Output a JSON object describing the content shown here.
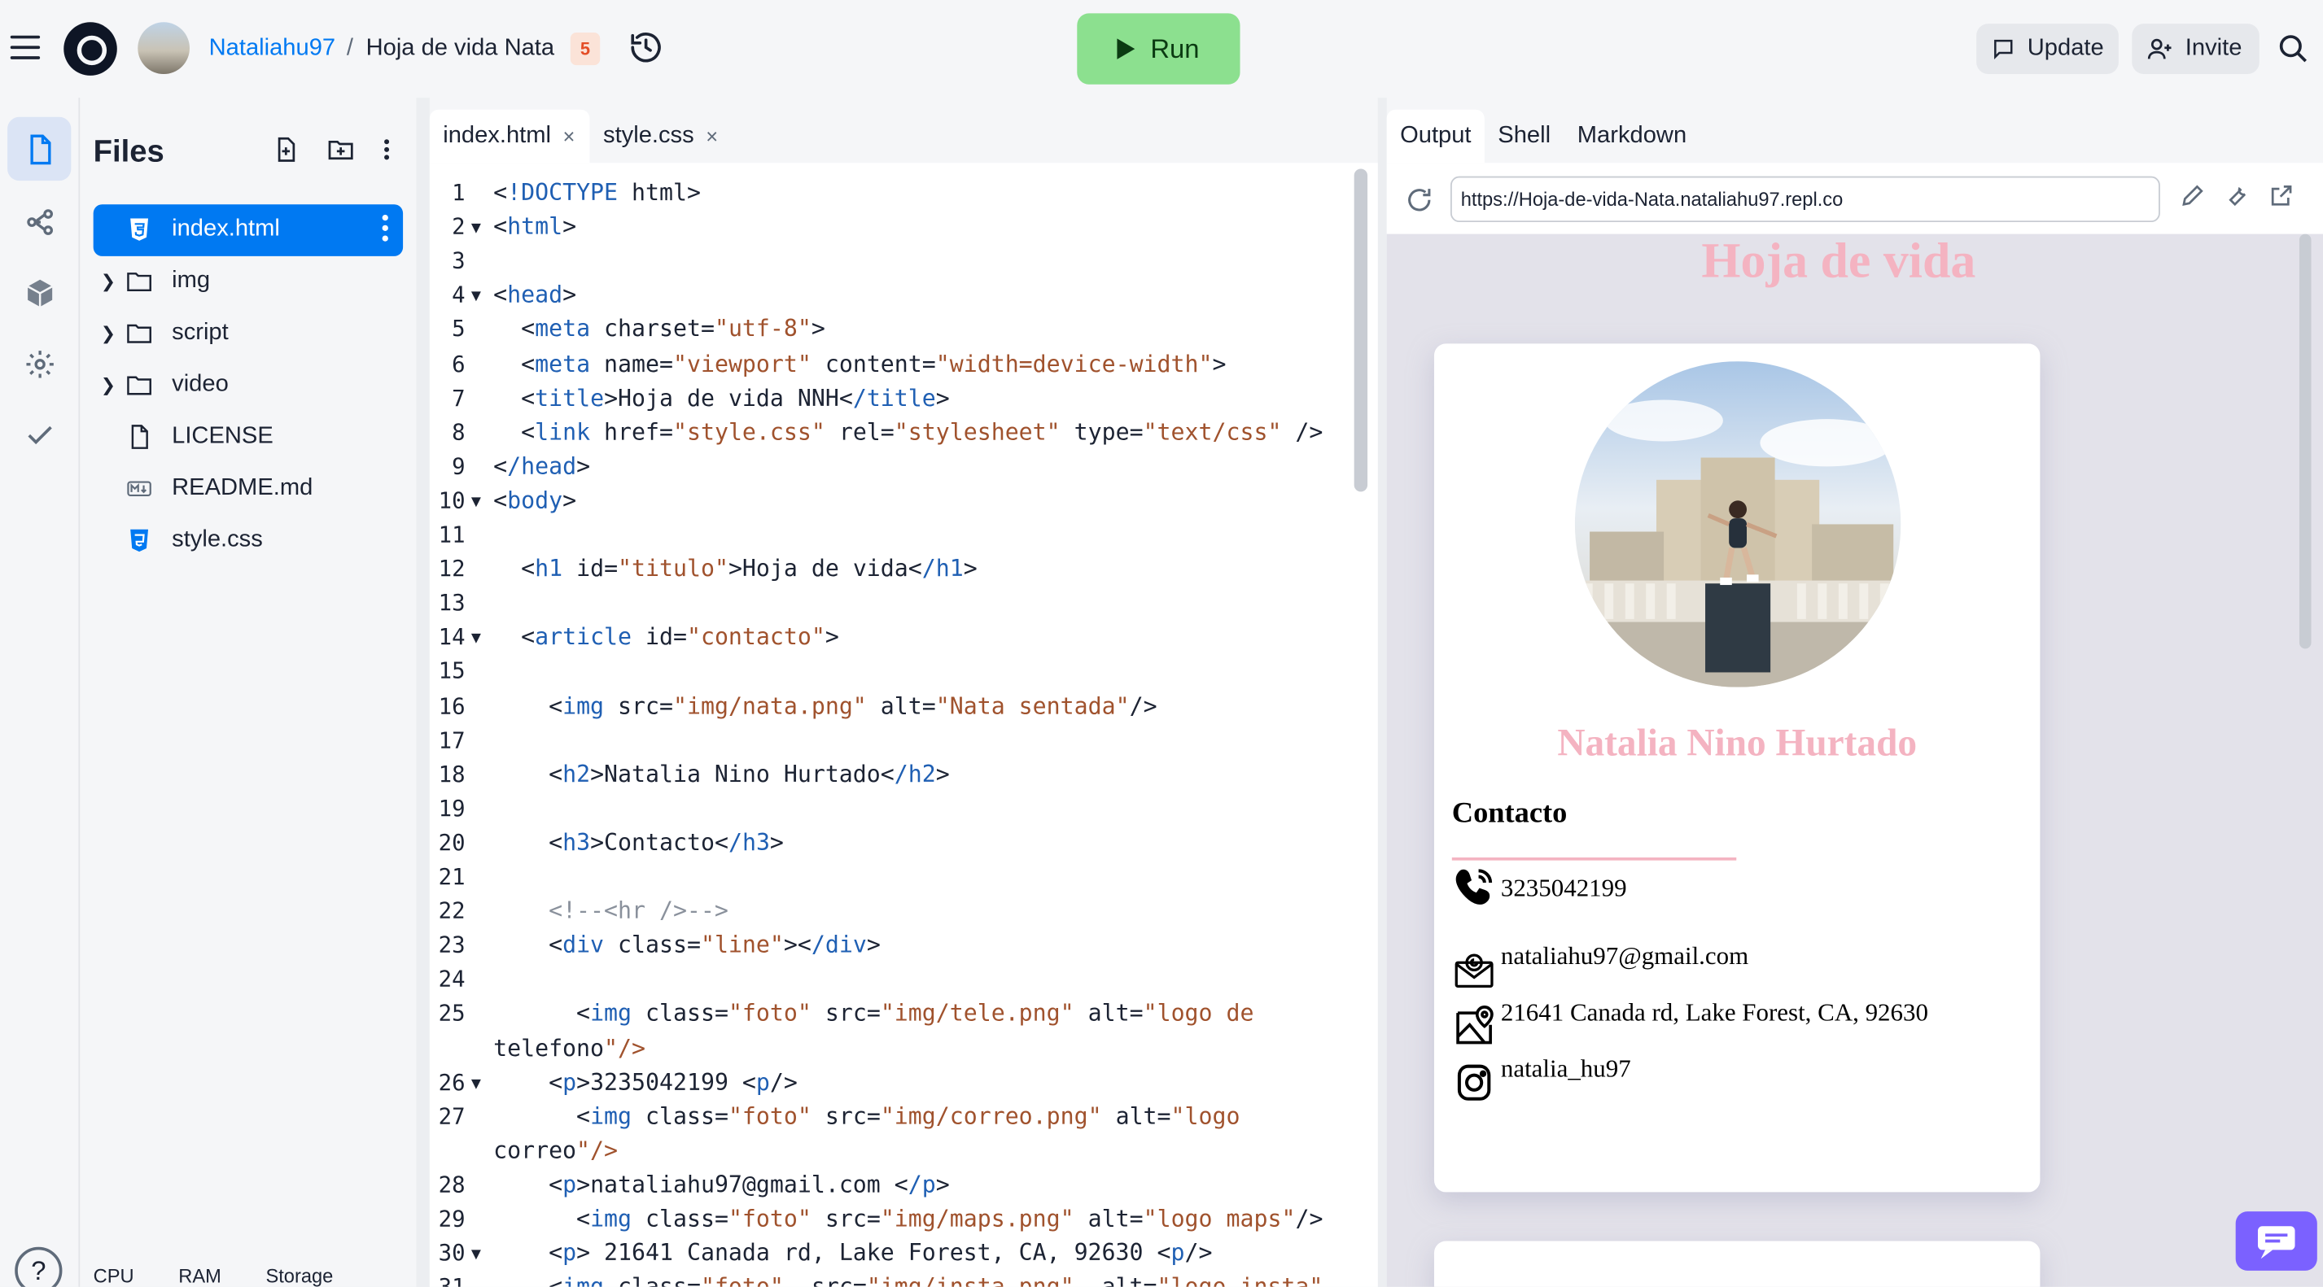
{
  "header": {
    "username": "Nataliahu97",
    "separator": "/",
    "repl_name": "Hoja de vida Nata",
    "repl_type_badge": "5",
    "run_label": "Run",
    "update_label": "Update",
    "invite_label": "Invite"
  },
  "files_panel": {
    "title": "Files",
    "items": [
      {
        "name": "index.html",
        "type": "html",
        "active": true
      },
      {
        "name": "img",
        "type": "folder"
      },
      {
        "name": "script",
        "type": "folder"
      },
      {
        "name": "video",
        "type": "folder"
      },
      {
        "name": "LICENSE",
        "type": "file"
      },
      {
        "name": "README.md",
        "type": "markdown"
      },
      {
        "name": "style.css",
        "type": "css"
      }
    ],
    "resources": [
      "CPU",
      "RAM",
      "Storage"
    ]
  },
  "editor": {
    "tabs": [
      {
        "label": "index.html",
        "active": true
      },
      {
        "label": "style.css",
        "active": false
      }
    ],
    "close_glyph": "×",
    "lines": [
      {
        "n": "1",
        "fold": "",
        "text": "<!DOCTYPE html>"
      },
      {
        "n": "2",
        "fold": "▼",
        "text": "<html>"
      },
      {
        "n": "3",
        "fold": "",
        "text": ""
      },
      {
        "n": "4",
        "fold": "▼",
        "text": "<head>"
      },
      {
        "n": "5",
        "fold": "",
        "text": "  <meta charset=\"utf-8\">"
      },
      {
        "n": "6",
        "fold": "",
        "text": "  <meta name=\"viewport\" content=\"width=device-width\">"
      },
      {
        "n": "7",
        "fold": "",
        "text": "  <title>Hoja de vida NNH</title>"
      },
      {
        "n": "8",
        "fold": "",
        "text": "  <link href=\"style.css\" rel=\"stylesheet\" type=\"text/css\" />"
      },
      {
        "n": "9",
        "fold": "",
        "text": "</head>"
      },
      {
        "n": "10",
        "fold": "▼",
        "text": "<body>"
      },
      {
        "n": "11",
        "fold": "",
        "text": ""
      },
      {
        "n": "12",
        "fold": "",
        "text": "  <h1 id=\"titulo\">Hoja de vida</h1>"
      },
      {
        "n": "13",
        "fold": "",
        "text": ""
      },
      {
        "n": "14",
        "fold": "▼",
        "text": "  <article id=\"contacto\">"
      },
      {
        "n": "15",
        "fold": "",
        "text": ""
      },
      {
        "n": "16",
        "fold": "",
        "text": "    <img src=\"img/nata.png\" alt=\"Nata sentada\"/>"
      },
      {
        "n": "17",
        "fold": "",
        "text": ""
      },
      {
        "n": "18",
        "fold": "",
        "text": "    <h2>Natalia Nino Hurtado</h2>"
      },
      {
        "n": "19",
        "fold": "",
        "text": ""
      },
      {
        "n": "20",
        "fold": "",
        "text": "    <h3>Contacto</h3>"
      },
      {
        "n": "21",
        "fold": "",
        "text": ""
      },
      {
        "n": "22",
        "fold": "",
        "text": "    <!--<hr />-->"
      },
      {
        "n": "23",
        "fold": "",
        "text": "    <div class=\"line\"></div>"
      },
      {
        "n": "24",
        "fold": "",
        "text": ""
      },
      {
        "n": "25",
        "fold": "",
        "text": "      <img class=\"foto\" src=\"img/tele.png\" alt=\"logo de"
      },
      {
        "n": "",
        "fold": "",
        "text": "telefono\"/>"
      },
      {
        "n": "26",
        "fold": "▼",
        "text": "    <p>3235042199 <p/>"
      },
      {
        "n": "27",
        "fold": "",
        "text": "      <img class=\"foto\" src=\"img/correo.png\" alt=\"logo"
      },
      {
        "n": "",
        "fold": "",
        "text": "correo\"/>"
      },
      {
        "n": "28",
        "fold": "",
        "text": "    <p>nataliahu97@gmail.com </p>"
      },
      {
        "n": "29",
        "fold": "",
        "text": "      <img class=\"foto\" src=\"img/maps.png\" alt=\"logo maps\"/>"
      },
      {
        "n": "30",
        "fold": "▼",
        "text": "    <p> 21641 Canada rd, Lake Forest, CA, 92630 <p/>"
      },
      {
        "n": "31",
        "fold": "",
        "text": "    <img class=\"foto\"  src=\"img/insta.png\"  alt=\"logo insta\""
      }
    ]
  },
  "output": {
    "tabs": [
      {
        "label": "Output",
        "active": true
      },
      {
        "label": "Shell",
        "active": false
      },
      {
        "label": "Markdown",
        "active": false
      }
    ],
    "url": "https://Hoja-de-vida-Nata.nataliahu97.repl.co",
    "page": {
      "title": "Hoja de vida",
      "name": "Natalia Nino Hurtado",
      "section": "Contacto",
      "contacts": [
        {
          "icon": "phone-icon",
          "text": "3235042199"
        },
        {
          "icon": "mail-icon",
          "text": "nataliahu97@gmail.com"
        },
        {
          "icon": "map-icon",
          "text": "21641 Canada rd, Lake Forest, CA, 92630"
        },
        {
          "icon": "instagram-icon",
          "text": "natalia_hu97"
        }
      ]
    }
  },
  "colors": {
    "accent_blue": "#0079f2",
    "run_green": "#8ce08f",
    "pink": "#f4b3c1",
    "chat_purple": "#7b61ff"
  }
}
